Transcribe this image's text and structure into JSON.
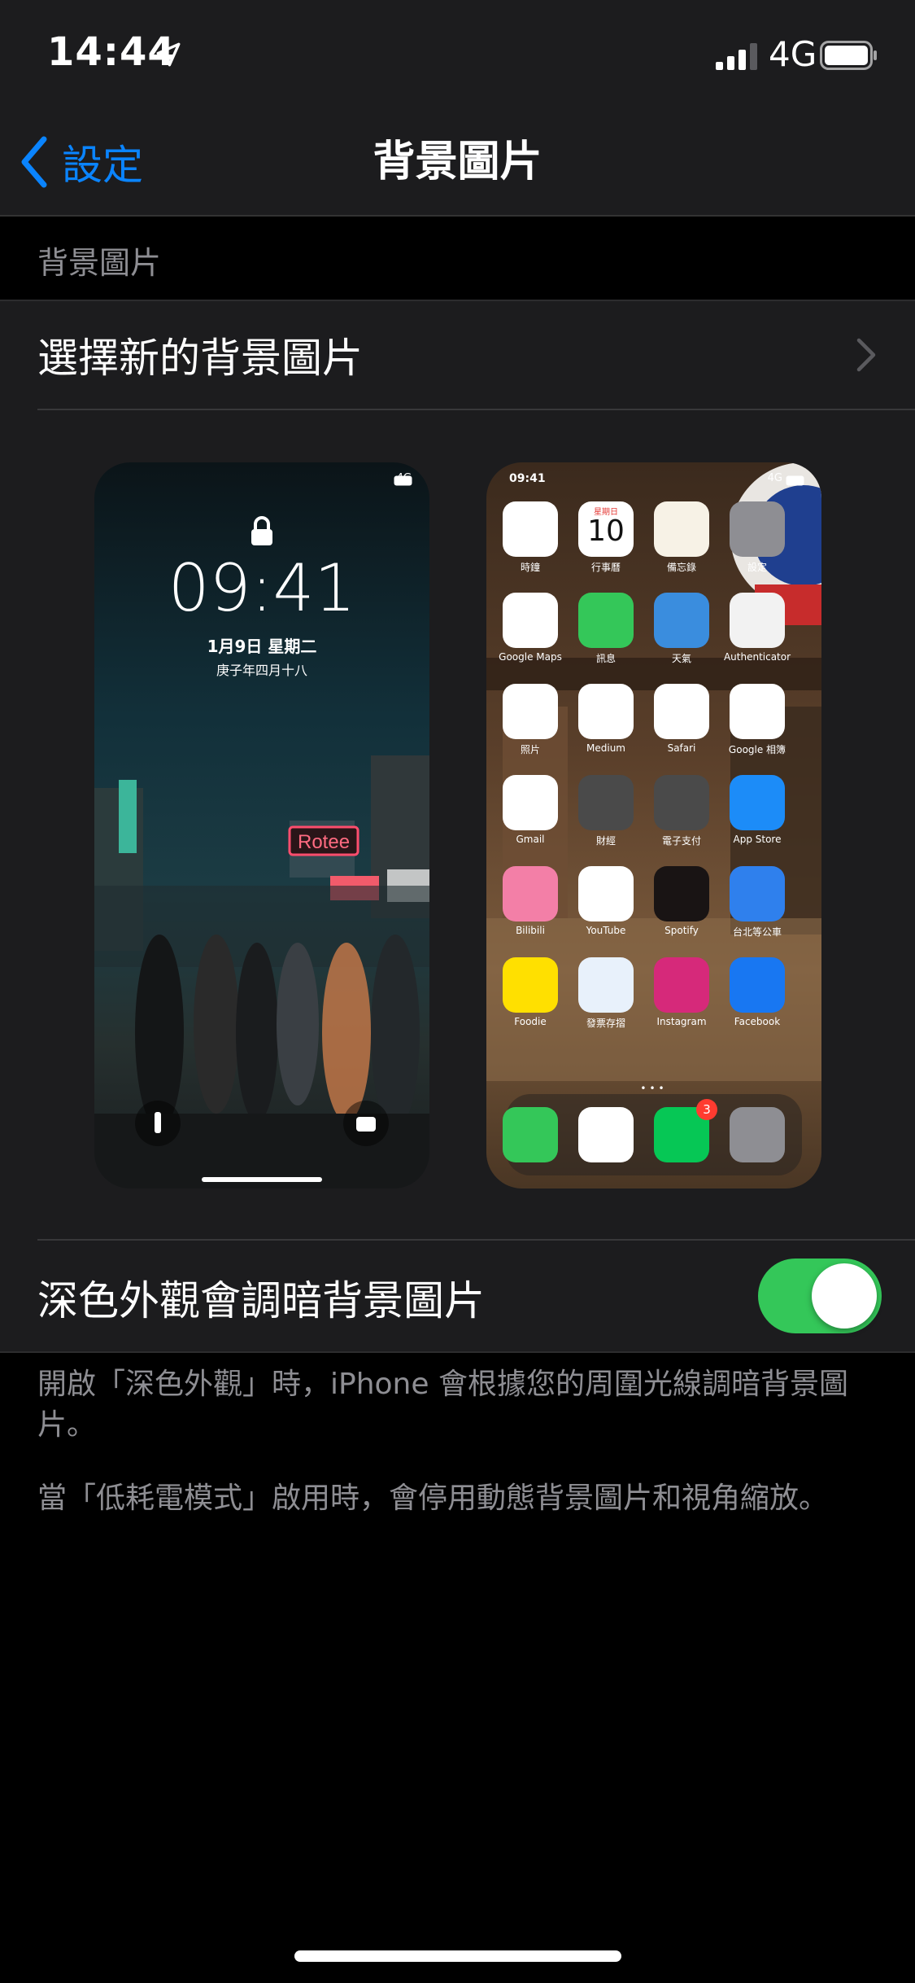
{
  "status_bar": {
    "time": "14:44",
    "network": "4G"
  },
  "nav": {
    "back_label": "設定",
    "title": "背景圖片"
  },
  "section_header": "背景圖片",
  "choose_row": {
    "label": "選擇新的背景圖片"
  },
  "lock_preview": {
    "network": "4G",
    "time": "09:41",
    "date": "1月9日 星期二",
    "lunar": "庚子年四月十八"
  },
  "home_preview": {
    "time": "09:41",
    "network": "4G",
    "apps": [
      {
        "label": "時鐘",
        "color": "#ffffff",
        "icon": "clock-icon"
      },
      {
        "label": "行事曆",
        "color": "#ffffff",
        "icon": "calendar-icon"
      },
      {
        "label": "備忘錄",
        "color": "#f7f2e6",
        "icon": "notes-icon"
      },
      {
        "label": "設定",
        "color": "#8e8e93",
        "icon": "settings-icon"
      },
      {
        "label": "Google Maps",
        "color": "#ffffff",
        "icon": "maps-icon"
      },
      {
        "label": "訊息",
        "color": "#34c759",
        "icon": "messages-icon"
      },
      {
        "label": "天氣",
        "color": "#3a8dde",
        "icon": "weather-icon"
      },
      {
        "label": "Authenticator",
        "color": "#f2f2f2",
        "icon": "authenticator-icon"
      },
      {
        "label": "照片",
        "color": "#ffffff",
        "icon": "photos-icon"
      },
      {
        "label": "Medium",
        "color": "#ffffff",
        "icon": "medium-icon"
      },
      {
        "label": "Safari",
        "color": "#ffffff",
        "icon": "safari-icon"
      },
      {
        "label": "Google 相簿",
        "color": "#ffffff",
        "icon": "google-photos-icon"
      },
      {
        "label": "Gmail",
        "color": "#ffffff",
        "icon": "gmail-icon"
      },
      {
        "label": "財經",
        "color": "#4a4a4a",
        "icon": "finance-folder-icon"
      },
      {
        "label": "電子支付",
        "color": "#4a4a4a",
        "icon": "payment-folder-icon"
      },
      {
        "label": "App Store",
        "color": "#1c8cf8",
        "icon": "app-store-icon"
      },
      {
        "label": "Bilibili",
        "color": "#f37fa7",
        "icon": "bilibili-icon"
      },
      {
        "label": "YouTube",
        "color": "#ffffff",
        "icon": "youtube-icon"
      },
      {
        "label": "Spotify",
        "color": "#191414",
        "icon": "spotify-icon"
      },
      {
        "label": "台北等公車",
        "color": "#2f80ed",
        "icon": "bus-icon"
      },
      {
        "label": "Foodie",
        "color": "#ffe000",
        "icon": "foodie-icon"
      },
      {
        "label": "發票存摺",
        "color": "#e8f1fb",
        "icon": "invoice-icon"
      },
      {
        "label": "Instagram",
        "color": "#d6297a",
        "icon": "instagram-icon"
      },
      {
        "label": "Facebook",
        "color": "#1877f2",
        "icon": "facebook-icon"
      }
    ],
    "dock": [
      {
        "icon": "phone-icon",
        "color": "#34c759"
      },
      {
        "icon": "messenger-icon",
        "color": "#ffffff"
      },
      {
        "icon": "line-icon",
        "color": "#06c755",
        "badge": "3"
      },
      {
        "icon": "camera-icon",
        "color": "#8e8e93"
      }
    ],
    "calendar_day": "星期日",
    "calendar_date": "10"
  },
  "dark_row": {
    "label": "深色外觀會調暗背景圖片",
    "enabled": true
  },
  "footnote1": "開啟「深色外觀」時，iPhone 會根據您的周圍光線調暗背景圖片。",
  "footnote2": "當「低耗電模式」啟用時，會停用動態背景圖片和視角縮放。",
  "colors": {
    "accent": "#0a84ff",
    "toggle_on": "#34c759",
    "grouped_background": "#1c1c1e"
  }
}
